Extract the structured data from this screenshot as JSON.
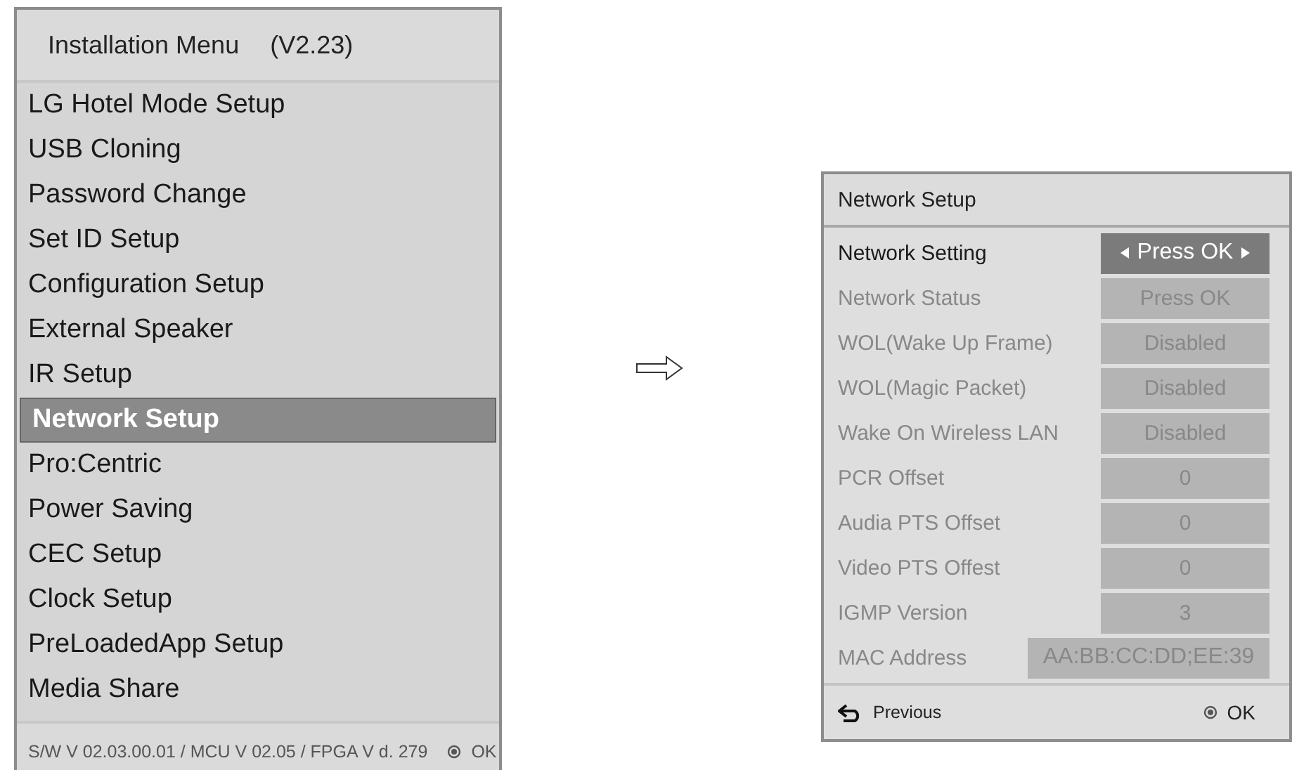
{
  "install_menu": {
    "title": "Installation Menu",
    "version": "(V2.23)",
    "items": [
      {
        "label": "LG Hotel Mode Setup",
        "selected": false
      },
      {
        "label": "USB Cloning",
        "selected": false
      },
      {
        "label": "Password Change",
        "selected": false
      },
      {
        "label": "Set ID Setup",
        "selected": false
      },
      {
        "label": "Configuration Setup",
        "selected": false
      },
      {
        "label": "External Speaker",
        "selected": false
      },
      {
        "label": "IR Setup",
        "selected": false
      },
      {
        "label": "Network Setup",
        "selected": true
      },
      {
        "label": "Pro:Centric",
        "selected": false
      },
      {
        "label": "Power Saving",
        "selected": false
      },
      {
        "label": "CEC Setup",
        "selected": false
      },
      {
        "label": "Clock Setup",
        "selected": false
      },
      {
        "label": "PreLoadedApp Setup",
        "selected": false
      },
      {
        "label": "Media Share",
        "selected": false
      }
    ],
    "footer": {
      "version_info": "S/W V 02.03.00.01 / MCU V 02.05 / FPGA V d. 279",
      "ok_label": "OK"
    }
  },
  "network_menu": {
    "title": "Network Setup",
    "rows": [
      {
        "label": "Network Setting",
        "value": "Press OK",
        "selected": true
      },
      {
        "label": "Network Status",
        "value": "Press OK",
        "selected": false
      },
      {
        "label": "WOL(Wake Up Frame)",
        "value": "Disabled",
        "selected": false
      },
      {
        "label": "WOL(Magic Packet)",
        "value": "Disabled",
        "selected": false
      },
      {
        "label": "Wake On Wireless LAN",
        "value": "Disabled",
        "selected": false
      },
      {
        "label": "PCR Offset",
        "value": "0",
        "selected": false
      },
      {
        "label": "Audia PTS Offset",
        "value": "0",
        "selected": false
      },
      {
        "label": "Video PTS Offest",
        "value": "0",
        "selected": false
      },
      {
        "label": "IGMP Version",
        "value": "3",
        "selected": false
      },
      {
        "label": "MAC Address",
        "value": "AA:BB:CC:DD;EE:39",
        "selected": false,
        "kind": "wide"
      }
    ],
    "footer": {
      "previous_label": "Previous",
      "ok_label": "OK"
    }
  }
}
